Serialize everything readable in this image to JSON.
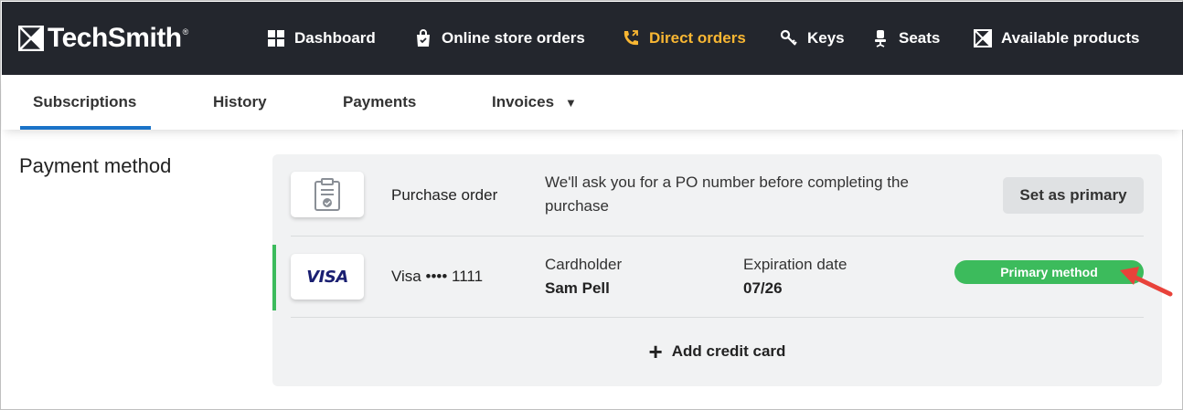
{
  "brand": {
    "name": "TechSmith",
    "reg": "®"
  },
  "nav": {
    "dashboard": "Dashboard",
    "online_store_orders": "Online store orders",
    "direct_orders": "Direct orders",
    "keys": "Keys",
    "seats": "Seats",
    "available_products": "Available products"
  },
  "tabs": {
    "subscriptions": "Subscriptions",
    "history": "History",
    "payments": "Payments",
    "invoices": "Invoices"
  },
  "section_title": "Payment method",
  "purchase_order": {
    "name": "Purchase order",
    "description": "We'll ask you for a PO number before completing the purchase",
    "action": "Set as primary"
  },
  "visa": {
    "brand_mark": "VISA",
    "name": "Visa •••• 1111",
    "cardholder_label": "Cardholder",
    "cardholder_value": "Sam Pell",
    "expiration_label": "Expiration date",
    "expiration_value": "07/26",
    "badge": "Primary method"
  },
  "add_card": {
    "plus": "+",
    "label": "Add credit card"
  },
  "colors": {
    "topbar": "#23262d",
    "active_nav": "#f9b733",
    "tab_underline": "#1a73c8",
    "primary_green": "#3cbb5c",
    "annotation_arrow": "#e8423a"
  }
}
